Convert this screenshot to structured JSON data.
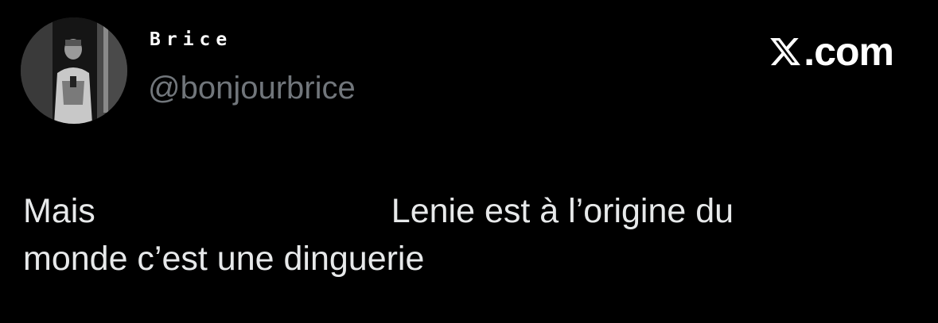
{
  "author": {
    "display_name": "Brice",
    "handle": "@bonjourbrice"
  },
  "brand": {
    "label": ".com",
    "icon": "x-logo-icon"
  },
  "tweet": {
    "line1_start": "Mais",
    "line1_end": "Lenie est à l’origine du",
    "line2": "monde c’est une dinguerie"
  },
  "colors": {
    "background": "#000000",
    "text": "#e7e9ea",
    "handle": "#71767b"
  }
}
